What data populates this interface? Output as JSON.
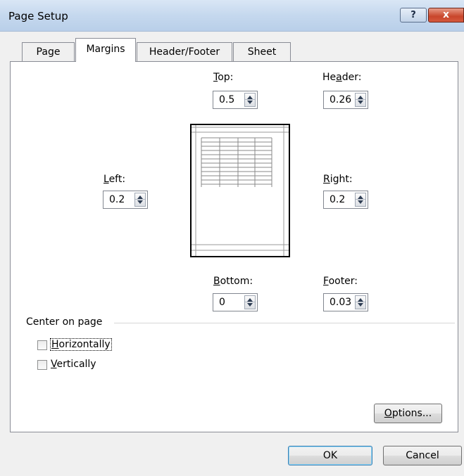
{
  "window": {
    "title": "Page Setup",
    "help_label": "?",
    "close_label": "x"
  },
  "tabs": [
    {
      "label": "Page",
      "active": false
    },
    {
      "label": "Margins",
      "active": true
    },
    {
      "label": "Header/Footer",
      "active": false
    },
    {
      "label": "Sheet",
      "active": false
    }
  ],
  "margins": {
    "top": {
      "label_pre": "",
      "label_ul": "T",
      "label_post": "op:",
      "value": "0.5"
    },
    "header": {
      "label_pre": "He",
      "label_ul": "a",
      "label_post": "der:",
      "value": "0.26"
    },
    "left": {
      "label_pre": "",
      "label_ul": "L",
      "label_post": "eft:",
      "value": "0.2"
    },
    "right": {
      "label_pre": "",
      "label_ul": "R",
      "label_post": "ight:",
      "value": "0.2"
    },
    "bottom": {
      "label_pre": "",
      "label_ul": "B",
      "label_post": "ottom:",
      "value": "0"
    },
    "footer": {
      "label_pre": "",
      "label_ul": "F",
      "label_post": "ooter:",
      "value": "0.03"
    }
  },
  "center_on_page": {
    "title": "Center on page",
    "horizontally": {
      "label_ul": "H",
      "label_post": "orizontally",
      "checked": false
    },
    "vertically": {
      "label_ul": "V",
      "label_post": "ertically",
      "checked": false
    }
  },
  "buttons": {
    "options_ul": "O",
    "options_post": "ptions...",
    "ok": "OK",
    "cancel": "Cancel"
  }
}
